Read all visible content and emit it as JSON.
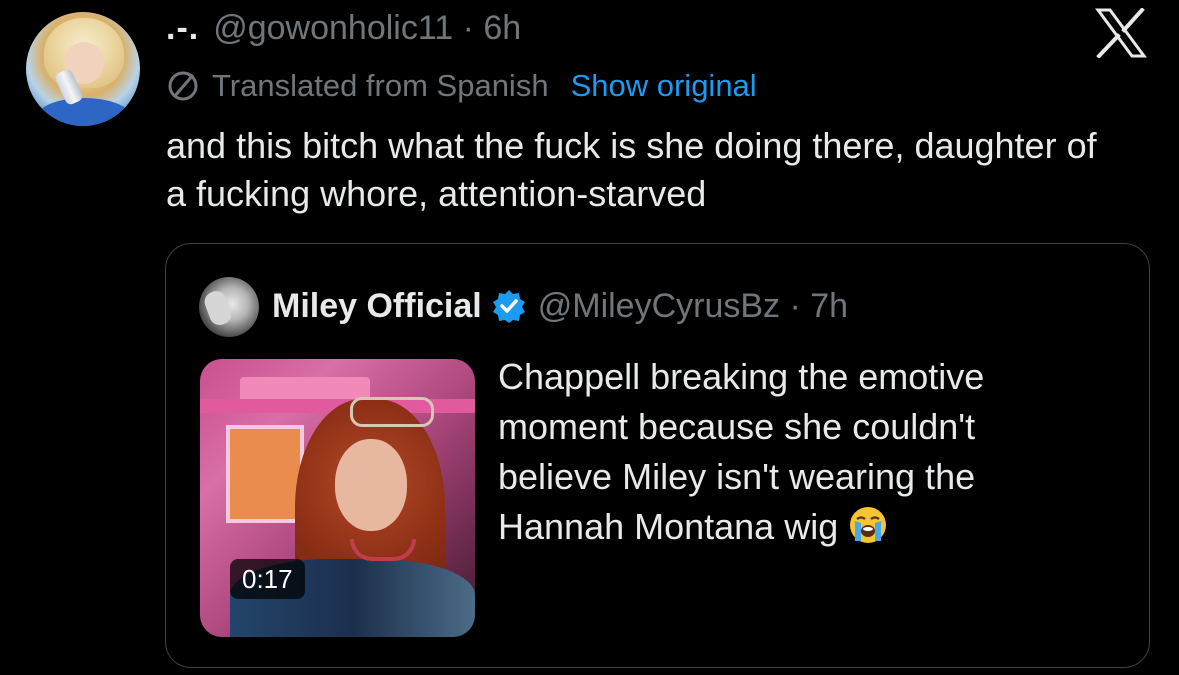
{
  "post": {
    "display_name": ".-.",
    "handle_meta": "@gowonholic11 · 6h",
    "translation_note": "Translated from Spanish",
    "show_original_label": "Show original",
    "text": "and this bitch what the fuck is she doing there, daughter of a fucking whore, attention-starved"
  },
  "quote": {
    "name": "Miley Official",
    "handle_meta": "@MileyCyrusBz · 7h",
    "text": "Chappell breaking the emotive moment because she couldn't believe Miley isn't wearing the Hannah Montana wig",
    "video_duration": "0:17"
  },
  "icons": {
    "brand": "x-logo-icon",
    "translate": "globe-translate-icon",
    "verified": "verified-badge-icon",
    "emoji": "loudly-crying-face-emoji"
  },
  "colors": {
    "background": "#000000",
    "text_primary": "#e7e9ea",
    "text_secondary": "#71767b",
    "link": "#1d9bf0",
    "verified": "#1d9bf0",
    "border": "#3b3f43"
  }
}
